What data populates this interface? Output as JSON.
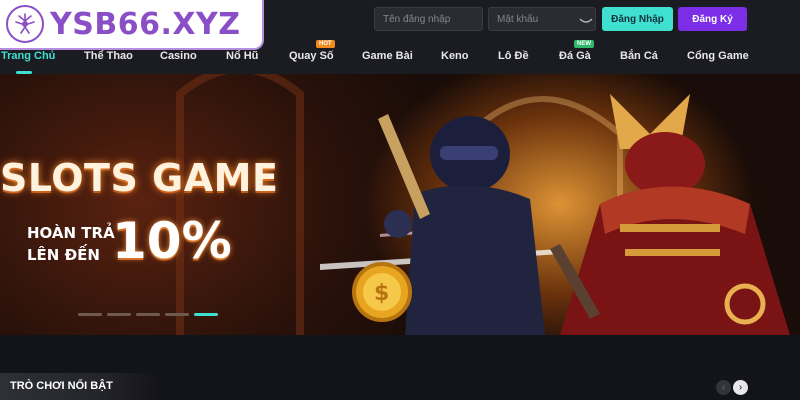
{
  "brand": {
    "logo_text": "YSB66.XYZ",
    "accent": "#8a4fc7"
  },
  "auth": {
    "username_placeholder": "Tên đăng nhập",
    "password_placeholder": "Mật khẩu",
    "login_label": "Đăng Nhập",
    "register_label": "Đăng Ký",
    "login_color": "#3fe0d0",
    "register_color": "#7b2ee6"
  },
  "nav": {
    "items": [
      {
        "label": "Trang Chủ",
        "active": true
      },
      {
        "label": "Thể Thao"
      },
      {
        "label": "Casino"
      },
      {
        "label": "Nổ Hũ"
      },
      {
        "label": "Quay Số",
        "badge": "HOT"
      },
      {
        "label": "Game Bài"
      },
      {
        "label": "Keno"
      },
      {
        "label": "Lô Đề"
      },
      {
        "label": "Đá Gà",
        "badge": "NEW"
      },
      {
        "label": "Bắn Cá"
      },
      {
        "label": "Cổng Game"
      }
    ]
  },
  "banner": {
    "title": "SLOTS GAME",
    "promo_line1": "HOÀN TRẢ",
    "promo_line2": "LÊN ĐẾN",
    "promo_value": "10%",
    "slide_count": 5,
    "active_slide": 5
  },
  "featured": {
    "title": "TRÒ CHƠI NỔI BẬT",
    "prev_icon": "‹",
    "next_icon": "›"
  }
}
